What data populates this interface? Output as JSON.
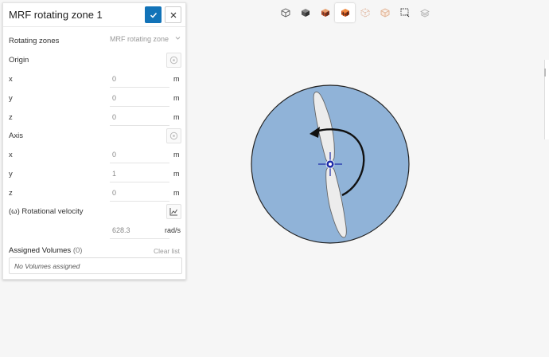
{
  "panel": {
    "title": "MRF rotating zone 1",
    "rotating_zones": {
      "label": "Rotating zones",
      "value": "MRF rotating zone"
    },
    "origin": {
      "label": "Origin",
      "x_label": "x",
      "x_value": "0",
      "y_label": "y",
      "y_value": "0",
      "z_label": "z",
      "z_value": "0",
      "unit": "m"
    },
    "axis": {
      "label": "Axis",
      "x_label": "x",
      "x_value": "0",
      "y_label": "y",
      "y_value": "1",
      "z_label": "z",
      "z_value": "0",
      "unit": "m"
    },
    "rotational_velocity": {
      "label": "(ω) Rotational velocity",
      "value": "628.3",
      "unit": "rad/s"
    },
    "assigned_volumes": {
      "label": "Assigned Volumes",
      "count": "(0)",
      "clear": "Clear list",
      "empty": "No Volumes assigned"
    }
  },
  "toolbar": {
    "icons": [
      "cube-outline-icon",
      "cube-solid-icon",
      "cube-mesh-red-icon",
      "cube-mesh-solid-icon",
      "cube-dotted-icon",
      "cube-faded-icon",
      "box-select-icon",
      "layers-icon"
    ],
    "active_index": 3
  },
  "colors": {
    "accent": "#1273b8",
    "zone_fill": "#90b3d8",
    "blade": "#e9e9e9"
  }
}
